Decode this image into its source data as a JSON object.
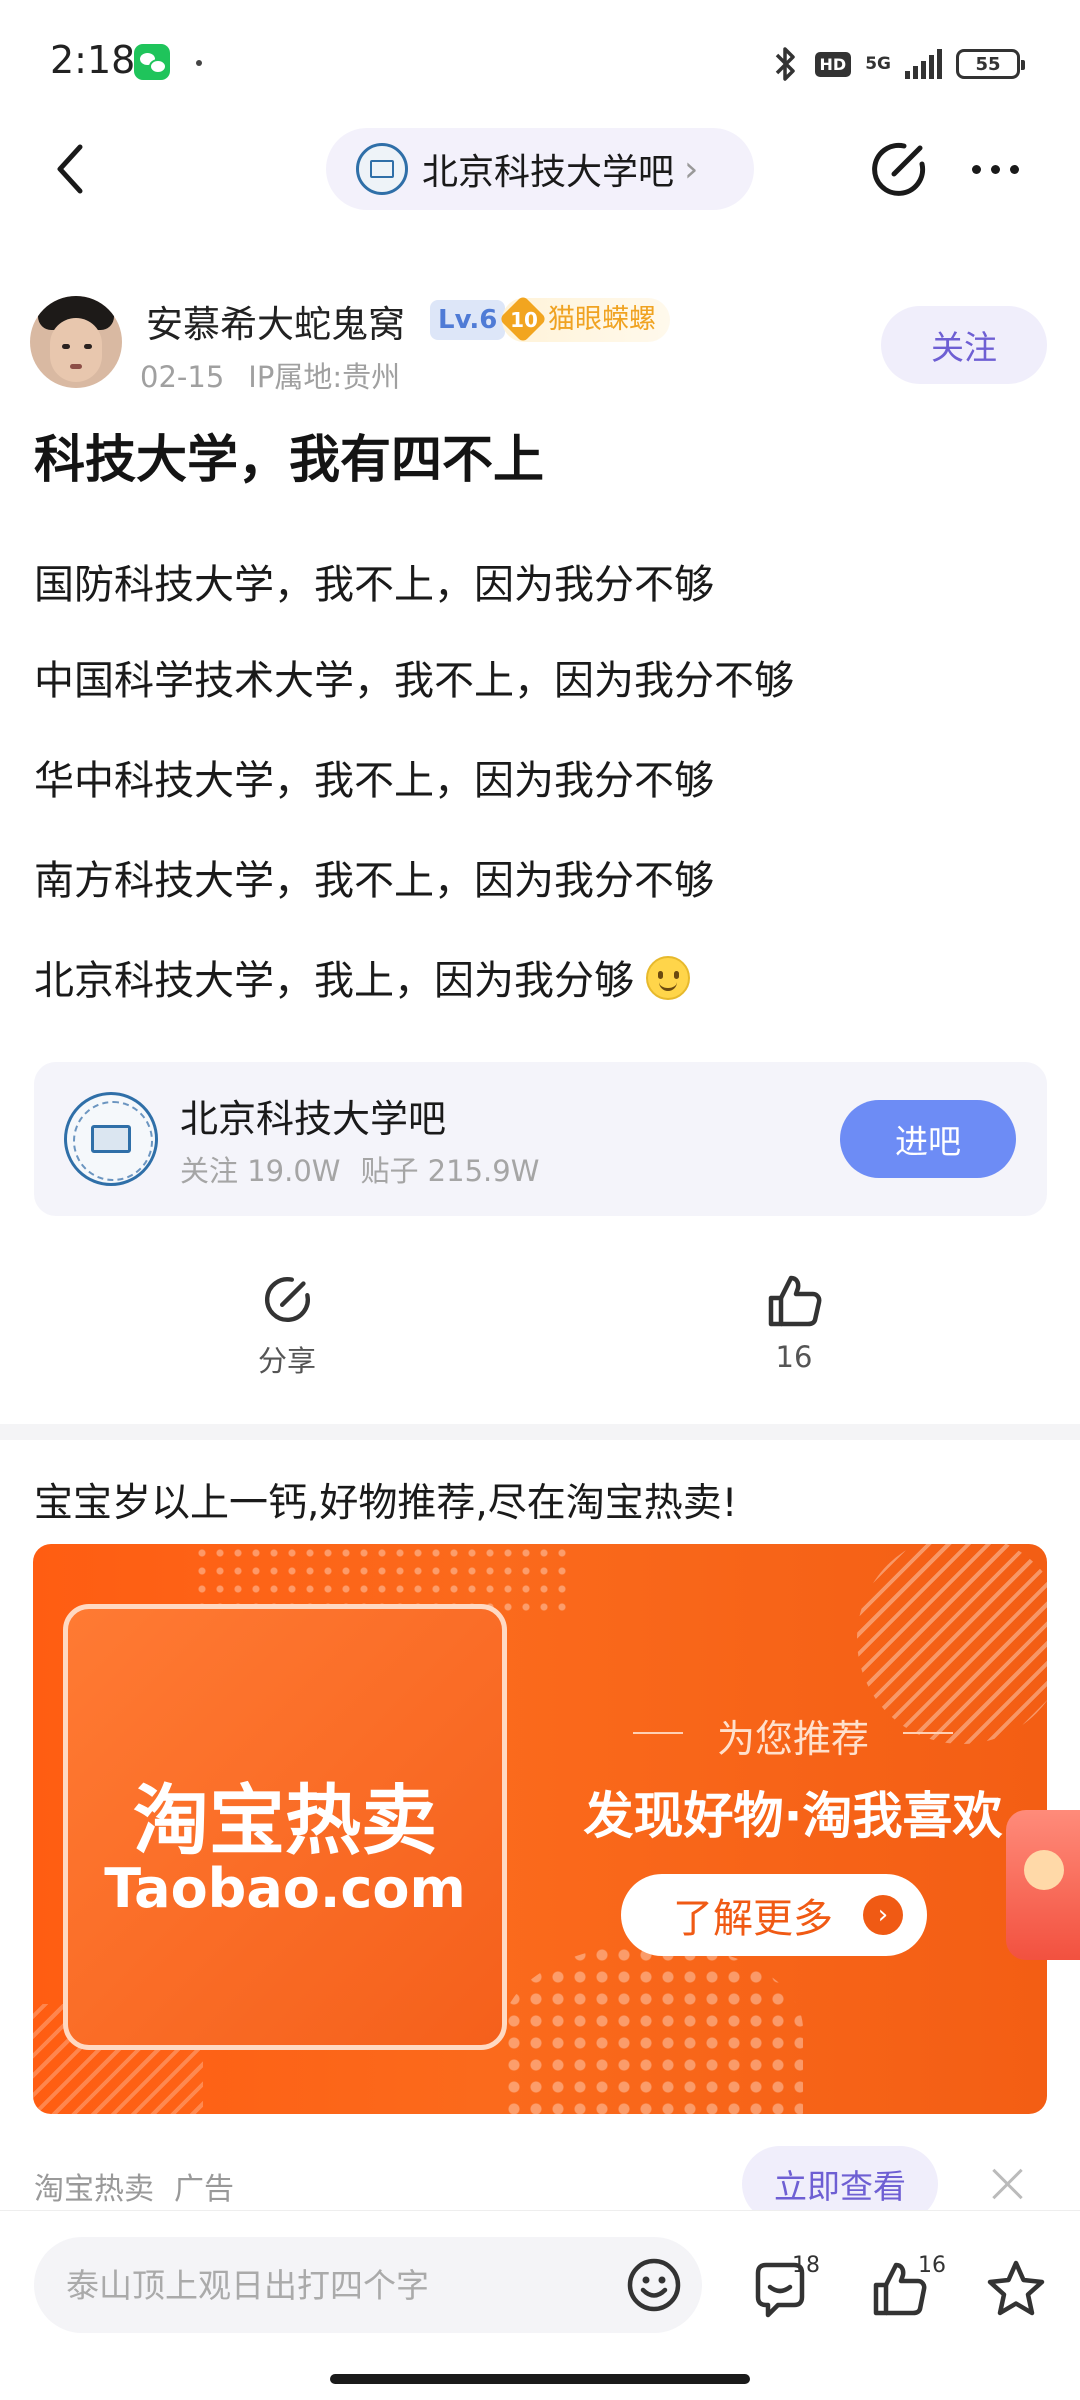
{
  "status_bar": {
    "time": "2:18",
    "network": "5G",
    "hd": "HD",
    "battery": "55"
  },
  "navbar": {
    "forum_name": "北京科技大学吧",
    "chevron": "›"
  },
  "author": {
    "name": "安慕希大蛇鬼窝",
    "level": "Lv.6",
    "fan_level": "10",
    "fan_title": "猫眼蝾螺",
    "date": "02-15",
    "ip_location": "IP属地:贵州",
    "follow_label": "关注"
  },
  "post": {
    "title": "科技大学，我有四不上",
    "lines": [
      "国防科技大学，我不上，因为我分不够",
      "中国科学技术大学，我不上，因为我分不够",
      "华中科技大学，我不上，因为我分不够",
      "南方科技大学，我不上，因为我分不够",
      "北京科技大学，我上，因为我分够"
    ]
  },
  "forum_card": {
    "name": "北京科技大学吧",
    "followers": "关注 19.0W",
    "posts": "贴子 215.9W",
    "enter_label": "进吧"
  },
  "actions": {
    "share_label": "分享",
    "like_count": "16"
  },
  "ad": {
    "title": "宝宝岁以上一钙,好物推荐,尽在淘宝热卖!",
    "brand": "淘宝热卖",
    "domain": "Taobao.com",
    "subtitle": "为您推荐",
    "headline": "发现好物·淘我喜欢",
    "cta": "了解更多",
    "source": "淘宝热卖",
    "ad_tag": "广告",
    "view_now": "立即查看"
  },
  "bottom_bar": {
    "input_placeholder": "泰山顶上观日出打四个字",
    "comment_count": "18",
    "like_count": "16"
  },
  "colors": {
    "accent": "#6e5fd3",
    "enter_button": "#6d8cf5",
    "ad_orange": "#ff5d12"
  },
  "icons": [
    "back-icon",
    "chevron-right-icon",
    "edit-icon",
    "more-icon",
    "share-icon",
    "thumbs-up-icon",
    "emoji-icon",
    "comment-icon",
    "star-icon",
    "close-icon",
    "bluetooth-icon",
    "wechat-icon"
  ]
}
